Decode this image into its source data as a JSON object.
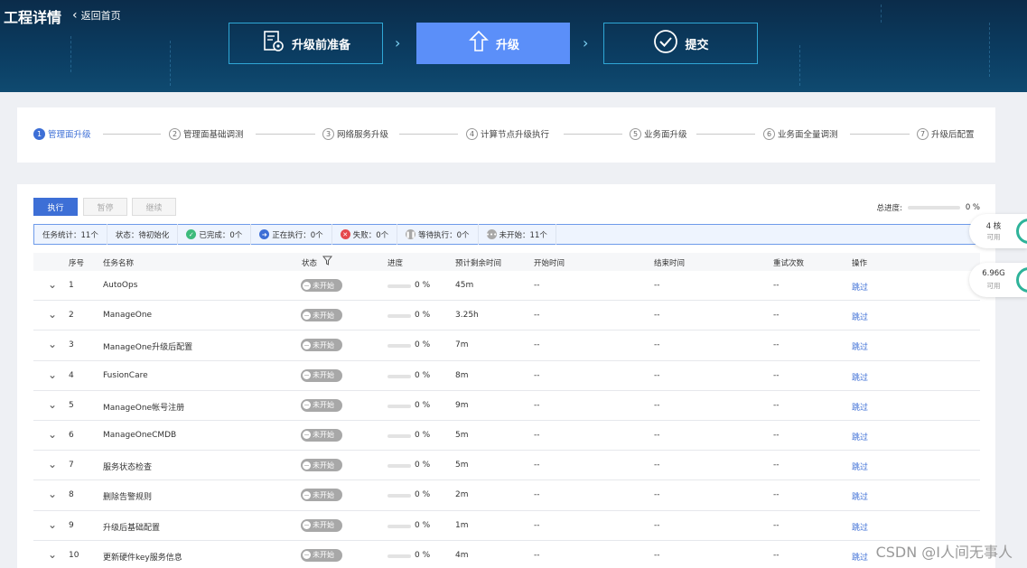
{
  "header": {
    "title": "工程详情",
    "back_label": "返回首页",
    "steps": [
      {
        "label": "升级前准备",
        "icon": "document-gear-icon",
        "active": false
      },
      {
        "label": "升级",
        "icon": "upload-arrow-icon",
        "active": true
      },
      {
        "label": "提交",
        "icon": "check-circle-icon",
        "active": false
      }
    ]
  },
  "stepper": {
    "items": [
      {
        "num": "1",
        "label": "管理面升级",
        "current": true
      },
      {
        "num": "2",
        "label": "管理面基础调测",
        "current": false
      },
      {
        "num": "3",
        "label": "网络服务升级",
        "current": false
      },
      {
        "num": "4",
        "label": "计算节点升级执行",
        "current": false
      },
      {
        "num": "5",
        "label": "业务面升级",
        "current": false
      },
      {
        "num": "6",
        "label": "业务面全量调测",
        "current": false
      },
      {
        "num": "7",
        "label": "升级后配置",
        "current": false
      }
    ]
  },
  "toolbar": {
    "execute_label": "执行",
    "pause_label": "暂停",
    "continue_label": "继续",
    "total_progress_label": "总进度:",
    "total_progress_value": "0 %",
    "total_progress": 0
  },
  "stats": {
    "task_count": "任务统计：11个",
    "state": "状态：待初始化",
    "done": "已完成：0个",
    "running": "正在执行：0个",
    "failed": "失败：0个",
    "waiting": "等待执行：0个",
    "not_started": "未开始：11个"
  },
  "table": {
    "headers": {
      "index": "序号",
      "name": "任务名称",
      "status": "状态",
      "progress": "进度",
      "eta": "预计剩余时间",
      "start": "开始时间",
      "end": "结束时间",
      "retries": "重试次数",
      "action": "操作"
    },
    "rows": [
      {
        "index": "1",
        "name": "AutoOps",
        "status": "未开始",
        "progress": "0 %",
        "eta": "45m",
        "start": "--",
        "end": "--",
        "retries": "--",
        "action": "跳过"
      },
      {
        "index": "2",
        "name": "ManageOne",
        "status": "未开始",
        "progress": "0 %",
        "eta": "3.25h",
        "start": "--",
        "end": "--",
        "retries": "--",
        "action": "跳过"
      },
      {
        "index": "3",
        "name": "ManageOne升级后配置",
        "status": "未开始",
        "progress": "0 %",
        "eta": "7m",
        "start": "--",
        "end": "--",
        "retries": "--",
        "action": "跳过"
      },
      {
        "index": "4",
        "name": "FusionCare",
        "status": "未开始",
        "progress": "0 %",
        "eta": "8m",
        "start": "--",
        "end": "--",
        "retries": "--",
        "action": "跳过"
      },
      {
        "index": "5",
        "name": "ManageOne帐号注册",
        "status": "未开始",
        "progress": "0 %",
        "eta": "9m",
        "start": "--",
        "end": "--",
        "retries": "--",
        "action": "跳过"
      },
      {
        "index": "6",
        "name": "ManageOneCMDB",
        "status": "未开始",
        "progress": "0 %",
        "eta": "5m",
        "start": "--",
        "end": "--",
        "retries": "--",
        "action": "跳过"
      },
      {
        "index": "7",
        "name": "服务状态检查",
        "status": "未开始",
        "progress": "0 %",
        "eta": "5m",
        "start": "--",
        "end": "--",
        "retries": "--",
        "action": "跳过"
      },
      {
        "index": "8",
        "name": "删除告警规则",
        "status": "未开始",
        "progress": "0 %",
        "eta": "2m",
        "start": "--",
        "end": "--",
        "retries": "--",
        "action": "跳过"
      },
      {
        "index": "9",
        "name": "升级后基础配置",
        "status": "未开始",
        "progress": "0 %",
        "eta": "1m",
        "start": "--",
        "end": "--",
        "retries": "--",
        "action": "跳过"
      },
      {
        "index": "10",
        "name": "更新硬件key服务信息",
        "status": "未开始",
        "progress": "0 %",
        "eta": "4m",
        "start": "--",
        "end": "--",
        "retries": "--",
        "action": "跳过"
      }
    ]
  },
  "side": {
    "cpu_value": "4 核",
    "cpu_unit": "可用",
    "mem_value": "6.96G",
    "mem_unit": "可用"
  },
  "watermark": "CSDN @I人间无事人",
  "colors": {
    "header_bg": "#0b3d62",
    "accent": "#3d6fd6",
    "active_step": "#5b8ff9",
    "badge_gray": "#a8a8a8"
  }
}
